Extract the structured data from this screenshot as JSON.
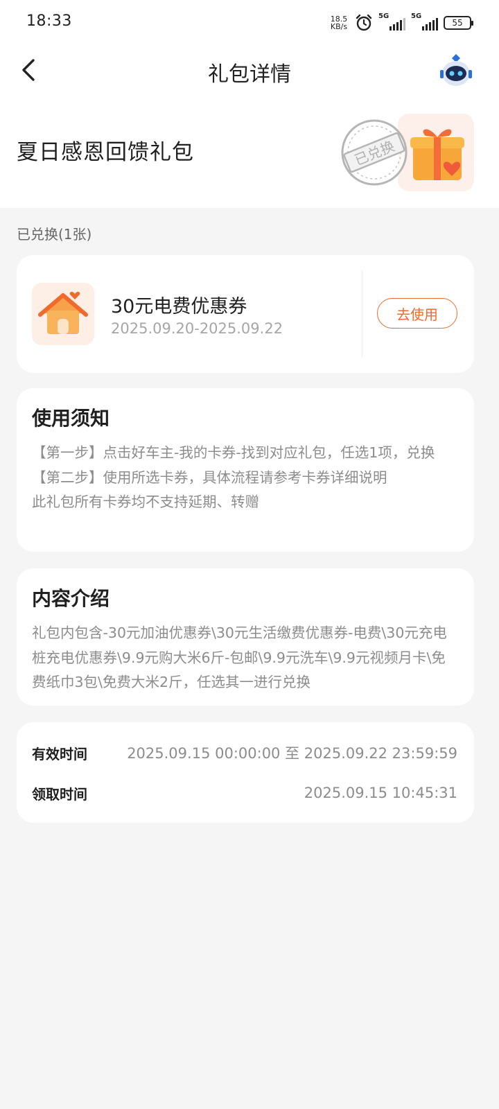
{
  "status_bar": {
    "time": "18:33",
    "net_speed_value": "18.5",
    "net_speed_unit": "KB/s",
    "sim1_label": "5G",
    "sim2_label": "5G",
    "battery": "55"
  },
  "header": {
    "title": "礼包详情",
    "gift_name": "夏日感恩回馈礼包",
    "stamp_text": "已兑换"
  },
  "redeemed_label": "已兑换(1张)",
  "coupon": {
    "title": "30元电费优惠券",
    "date_range": "2025.09.20-2025.09.22",
    "use_button": "去使用"
  },
  "notice": {
    "title": "使用须知",
    "lines": [
      "【第一步】点击好车主-我的卡券-找到对应礼包，任选1项，兑换",
      "【第二步】使用所选卡券，具体流程请参考卡券详细说明",
      "此礼包所有卡券均不支持延期、转赠"
    ]
  },
  "content_intro": {
    "title": "内容介绍",
    "text": "礼包内包含-30元加油优惠券\\30元生活缴费优惠券-电费\\30元充电桩充电优惠券\\9.9元购大米6斤-包邮\\9.9元洗车\\9.9元视频月卡\\免费纸巾3包\\免费大米2斤，任选其一进行兑换"
  },
  "times": {
    "valid_label": "有效时间",
    "valid_value": "2025.09.15 00:00:00 至 2025.09.22 23:59:59",
    "claim_label": "领取时间",
    "claim_value": "2025.09.15 10:45:31"
  },
  "colors": {
    "accent": "#f06a2c",
    "background": "#f5f5f5",
    "card": "#ffffff"
  },
  "icons": {
    "back": "chevron-left-icon",
    "avatar": "robot-avatar-icon",
    "gift": "gift-box-icon",
    "coupon": "house-icon",
    "alarm": "alarm-clock-icon"
  }
}
